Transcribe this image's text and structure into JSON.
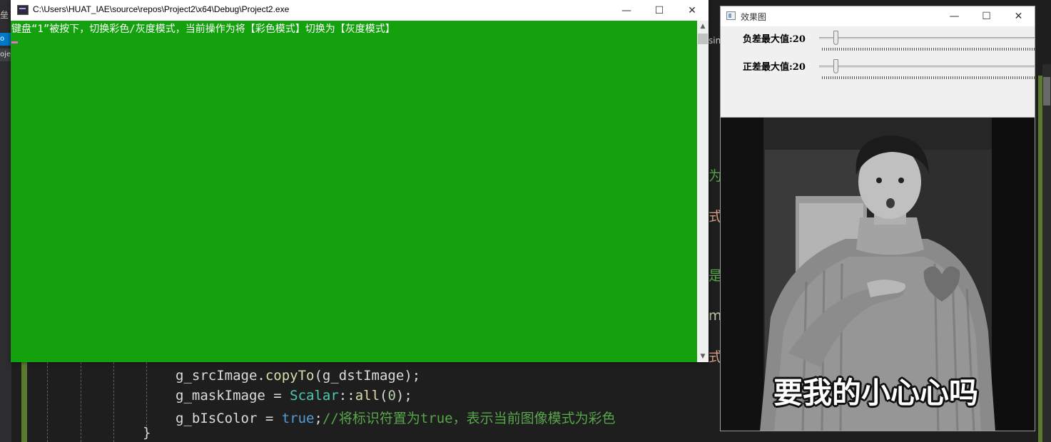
{
  "console": {
    "title": "C:\\Users\\HUAT_IAE\\source\\repos\\Project2\\x64\\Debug\\Project2.exe",
    "output_line": "键盘“1”被按下，切换彩色/灰度模式，当前操作为将【彩色模式】切换为【灰度模式】",
    "background_color": "#13a10e",
    "minimize_glyph": "—",
    "maximize_glyph": "☐",
    "close_glyph": "✕",
    "scroll_up_glyph": "▲",
    "scroll_down_glyph": "▼"
  },
  "effect_window": {
    "title": "效果图",
    "minimize_glyph": "—",
    "maximize_glyph": "☐",
    "close_glyph": "✕",
    "trackbars": [
      {
        "label": "负差最大值:20",
        "value": 20,
        "max": 255
      },
      {
        "label": "正差最大值:20",
        "value": 20,
        "max": 255
      }
    ],
    "image_caption": "要我的小心心吗",
    "image_mode": "grayscale"
  },
  "ide": {
    "code_lines": [
      {
        "a": "g_srcImage.",
        "b": "copyTo",
        "c": "(g_dstImage);"
      },
      {
        "a": "g_maskImage = ",
        "b": "Scalar",
        "c": "::",
        "d": "all",
        "e": "(",
        "f": "0",
        "g": ");"
      },
      {
        "a": "g_bIsColor = ",
        "b": "true",
        "c": ";",
        "d": "//将标识符置为true，表示当前图像模式为彩色"
      }
    ],
    "closing_brace": "}",
    "left_glyph": "垒",
    "left_tab_blue": "o",
    "left_tab_grey": "oje",
    "tab_fragment": "sin",
    "peek_fragments": [
      "为",
      "式",
      "是",
      "ma",
      "式"
    ]
  }
}
